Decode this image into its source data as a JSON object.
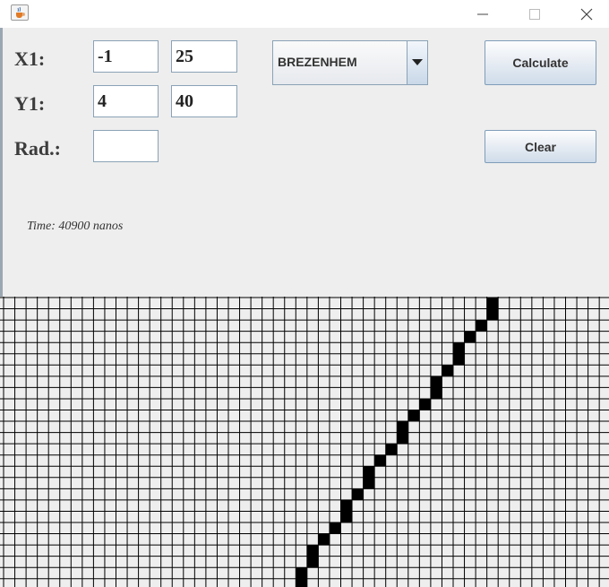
{
  "window": {
    "icon": "java-cup-icon",
    "controls": [
      "minimize-icon",
      "maximize-icon",
      "close-icon"
    ]
  },
  "labels": {
    "x1": "X1:",
    "y1": "Y1:",
    "rad": "Rad.:"
  },
  "inputs": {
    "x1_a": "-1",
    "x1_b": "25",
    "y1_a": "4",
    "y1_b": "40",
    "rad": ""
  },
  "algorithm": {
    "selected": "BREZENHEM"
  },
  "buttons": {
    "calculate": "Calculate",
    "clear": "Clear"
  },
  "status": {
    "time": "Time: 40900 nanos"
  },
  "grid": {
    "columns": 54,
    "rows": 26,
    "filled_cells": [
      [
        43,
        0
      ],
      [
        43,
        1
      ],
      [
        42,
        2
      ],
      [
        41,
        3
      ],
      [
        40,
        4
      ],
      [
        40,
        5
      ],
      [
        39,
        6
      ],
      [
        38,
        7
      ],
      [
        38,
        8
      ],
      [
        37,
        9
      ],
      [
        36,
        10
      ],
      [
        35,
        11
      ],
      [
        35,
        12
      ],
      [
        34,
        13
      ],
      [
        33,
        14
      ],
      [
        32,
        15
      ],
      [
        32,
        16
      ],
      [
        31,
        17
      ],
      [
        30,
        18
      ],
      [
        30,
        19
      ],
      [
        29,
        20
      ],
      [
        28,
        21
      ],
      [
        27,
        22
      ],
      [
        27,
        23
      ],
      [
        26,
        24
      ],
      [
        26,
        25
      ]
    ]
  }
}
